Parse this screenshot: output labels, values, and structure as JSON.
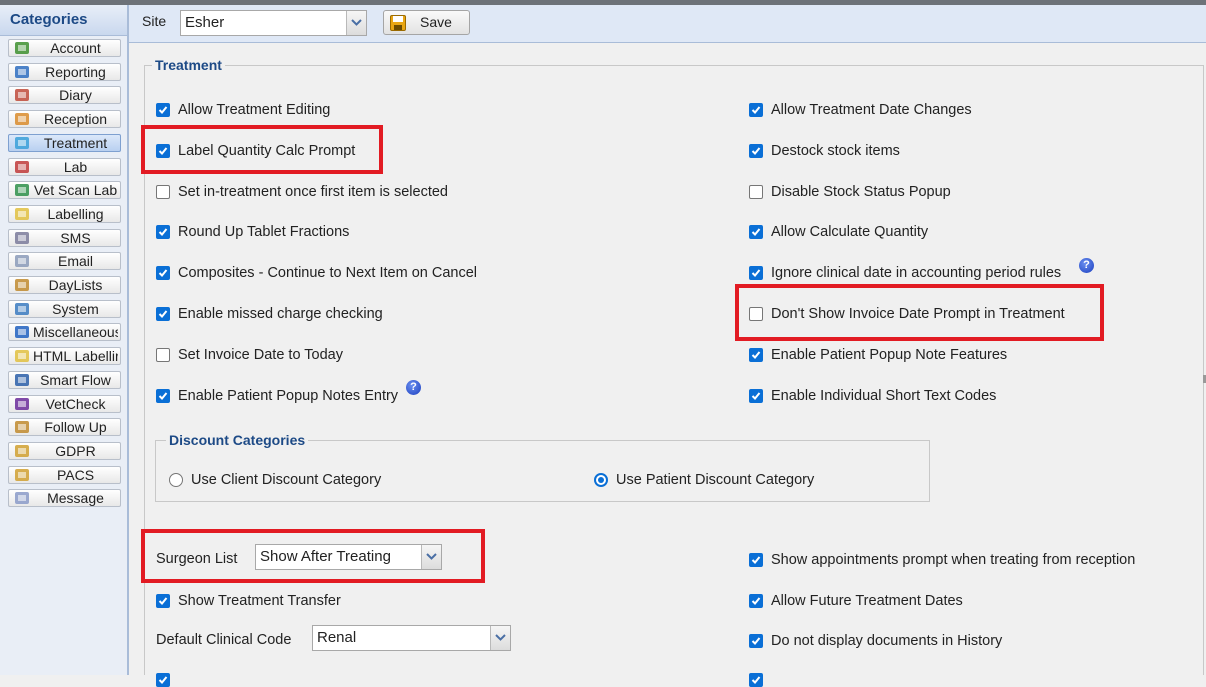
{
  "sidebar": {
    "header": "Categories",
    "items": [
      {
        "label": "Account",
        "icon": "account-icon",
        "active": false
      },
      {
        "label": "Reporting",
        "icon": "reporting-icon",
        "active": false
      },
      {
        "label": "Diary",
        "icon": "calendar-icon",
        "active": false
      },
      {
        "label": "Reception",
        "icon": "person-icon",
        "active": false
      },
      {
        "label": "Treatment",
        "icon": "treatment-icon",
        "active": true
      },
      {
        "label": "Lab",
        "icon": "lab-icon",
        "active": false
      },
      {
        "label": "Vet Scan Lab",
        "icon": "vetscan-icon",
        "active": false
      },
      {
        "label": "Labelling",
        "icon": "label-icon",
        "active": false
      },
      {
        "label": "SMS",
        "icon": "phone-icon",
        "active": false
      },
      {
        "label": "Email",
        "icon": "envelope-icon",
        "active": false
      },
      {
        "label": "DayLists",
        "icon": "list-icon",
        "active": false
      },
      {
        "label": "System",
        "icon": "system-icon",
        "active": false
      },
      {
        "label": "Miscellaneous",
        "icon": "info-icon",
        "active": false
      },
      {
        "label": "HTML Labellir",
        "icon": "label-icon",
        "active": false
      },
      {
        "label": "Smart Flow",
        "icon": "smartflow-icon",
        "active": false
      },
      {
        "label": "VetCheck",
        "icon": "vetcheck-icon",
        "active": false
      },
      {
        "label": "Follow Up",
        "icon": "list-icon",
        "active": false
      },
      {
        "label": "GDPR",
        "icon": "gdpr-icon",
        "active": false
      },
      {
        "label": "PACS",
        "icon": "pacs-icon",
        "active": false
      },
      {
        "label": "Message",
        "icon": "message-icon",
        "active": false
      }
    ]
  },
  "toolbar": {
    "site_label": "Site",
    "site_value": "Esher",
    "save_label": "Save"
  },
  "treatment": {
    "legend": "Treatment",
    "left": [
      {
        "label": "Allow Treatment Editing",
        "checked": true
      },
      {
        "label": "Label Quantity Calc Prompt",
        "checked": true
      },
      {
        "label": "Set in-treatment once first item is selected",
        "checked": false
      },
      {
        "label": "Round Up Tablet Fractions",
        "checked": true
      },
      {
        "label": "Composites - Continue to Next Item on Cancel",
        "checked": true
      },
      {
        "label": "Enable missed charge checking",
        "checked": true
      },
      {
        "label": "Set Invoice Date to Today",
        "checked": false
      },
      {
        "label": "Enable Patient Popup Notes Entry",
        "checked": true
      }
    ],
    "right": [
      {
        "label": "Allow Treatment Date Changes",
        "checked": true
      },
      {
        "label": "Destock stock items",
        "checked": true
      },
      {
        "label": "Disable Stock Status Popup",
        "checked": false
      },
      {
        "label": "Allow Calculate Quantity",
        "checked": true
      },
      {
        "label": "Ignore clinical date in accounting period rules",
        "checked": true
      },
      {
        "label": "Don't Show Invoice Date Prompt in Treatment",
        "checked": false
      },
      {
        "label": "Enable Patient Popup Note Features",
        "checked": true
      },
      {
        "label": "Enable Individual Short Text Codes",
        "checked": true
      }
    ],
    "help_glyph": "?"
  },
  "discount": {
    "legend": "Discount Categories",
    "client_label": "Use Client Discount Category",
    "patient_label": "Use Patient Discount Category",
    "selected": "patient"
  },
  "surgeon": {
    "label": "Surgeon List",
    "value": "Show After Treating"
  },
  "lower": {
    "show_transfer": {
      "label": "Show Treatment Transfer",
      "checked": true
    },
    "clinical_code_label": "Default Clinical Code",
    "clinical_code_value": "Renal",
    "right": [
      {
        "label": "Show appointments prompt when treating from reception",
        "checked": true
      },
      {
        "label": "Allow Future Treatment Dates",
        "checked": true
      },
      {
        "label": "Do not display documents in History",
        "checked": true
      }
    ]
  },
  "colors": {
    "accent": "#0a6fd6",
    "highlight": "#e21b23",
    "header_text": "#1d4a86"
  }
}
